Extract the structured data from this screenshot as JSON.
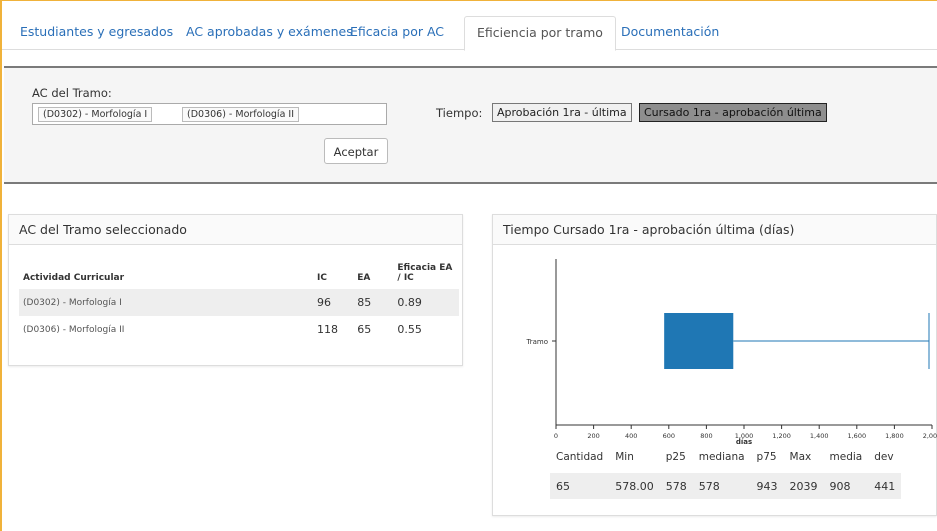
{
  "tabs": [
    {
      "label": "Estudiantes y egresados"
    },
    {
      "label": "AC aprobadas y exámenes"
    },
    {
      "label": "Eficacia por AC"
    },
    {
      "label": "Eficiencia por tramo"
    },
    {
      "label": "Documentación"
    }
  ],
  "active_tab": "Eficiencia por tramo",
  "filter": {
    "tramo_label": "AC del Tramo:",
    "selected_tags": [
      "(D0302) - Morfología I",
      "(D0306) - Morfología II"
    ],
    "accept_button": "Aceptar",
    "tiempo_label": "Tiempo:",
    "tiempo_options": [
      "Aprobación 1ra - última",
      "Cursado 1ra - aprobación última"
    ],
    "tiempo_selected": "Cursado 1ra - aprobación última"
  },
  "left_panel": {
    "title": "AC del Tramo seleccionado",
    "headers": [
      "Actividad Curricular",
      "IC",
      "EA",
      "Eficacia EA / IC"
    ],
    "rows": [
      {
        "name": "(D0302) - Morfología I",
        "ic": "96",
        "ea": "85",
        "eff": "0.89"
      },
      {
        "name": "(D0306) - Morfología II",
        "ic": "118",
        "ea": "65",
        "eff": "0.55"
      }
    ]
  },
  "right_panel": {
    "title": "Tiempo Cursado 1ra - aprobación última (días)",
    "stats_headers": [
      "Cantidad",
      "Min",
      "p25",
      "mediana",
      "p75",
      "Max",
      "media",
      "dev"
    ],
    "stats_values": [
      "65",
      "578.00",
      "578",
      "578",
      "943",
      "2039",
      "908",
      "441"
    ]
  },
  "chart_data": {
    "type": "boxplot",
    "title": "",
    "xlabel": "días",
    "ylabel": "",
    "categories": [
      "Tramo"
    ],
    "xlim": [
      0,
      2000
    ],
    "xticks": [
      "0",
      "200",
      "400",
      "600",
      "800",
      "1,000",
      "1,200",
      "1,400",
      "1,600",
      "1,800",
      "2,000"
    ],
    "box": {
      "min": 578,
      "q1": 578,
      "median": 578,
      "q3": 943,
      "max": 2039
    },
    "color": "#1f77b4"
  }
}
